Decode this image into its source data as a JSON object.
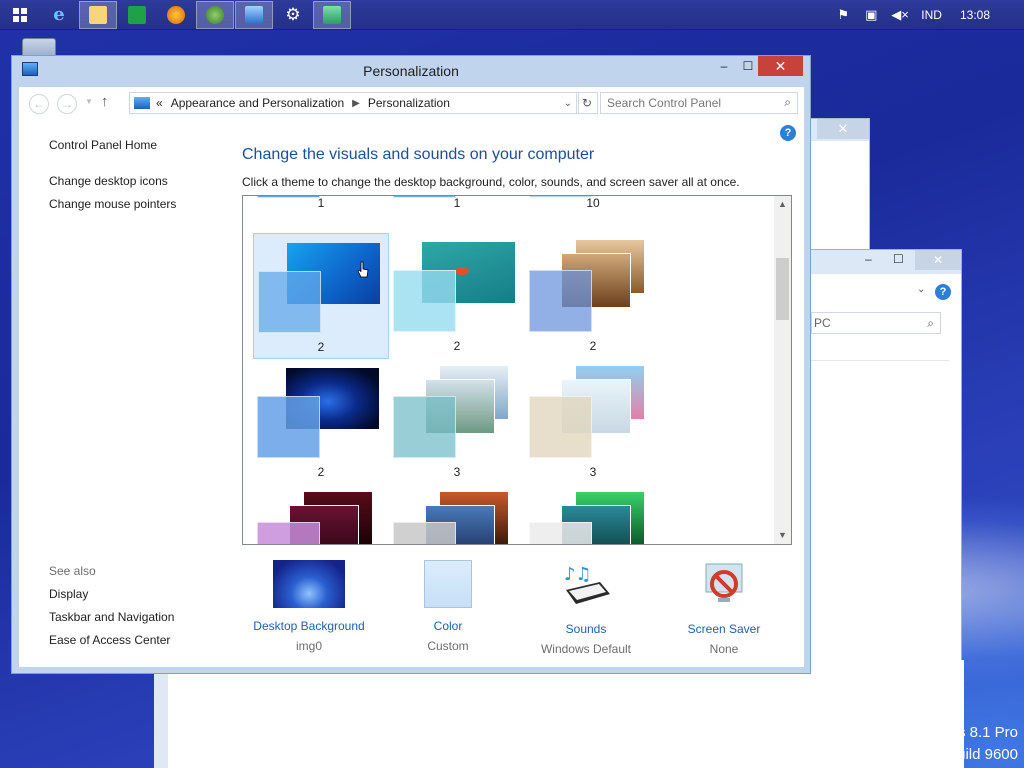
{
  "taskbar": {
    "lang": "IND",
    "clock": "13:08"
  },
  "window": {
    "title": "Personalization",
    "breadcrumb": [
      "Appearance and Personalization",
      "Personalization"
    ],
    "breadcrumb_prefix": "«",
    "search_placeholder": "Search Control Panel",
    "min_label": "–",
    "max_label": "☐",
    "close_label": "✕",
    "help_label": "?"
  },
  "sidebar": {
    "home": "Control Panel Home",
    "links": [
      "Change desktop icons",
      "Change mouse pointers"
    ],
    "see_also_title": "See also",
    "see_also": [
      "Display",
      "Taskbar and Navigation",
      "Ease of Access Center"
    ]
  },
  "main": {
    "heading": "Change the visuals and sounds on your computer",
    "subheading": "Click a theme to change the desktop background, color, sounds, and screen saver all at once."
  },
  "themes": [
    {
      "label": "1",
      "row": -1,
      "col": 0
    },
    {
      "label": "1",
      "row": -1,
      "col": 1
    },
    {
      "label": "10",
      "row": -1,
      "col": 2
    },
    {
      "label": "2",
      "row": 0,
      "col": 0,
      "selected": true
    },
    {
      "label": "2",
      "row": 0,
      "col": 1
    },
    {
      "label": "2",
      "row": 0,
      "col": 2
    },
    {
      "label": "2",
      "row": 1,
      "col": 0
    },
    {
      "label": "3",
      "row": 1,
      "col": 1
    },
    {
      "label": "3",
      "row": 1,
      "col": 2
    }
  ],
  "bottom": {
    "items": [
      {
        "label": "Desktop Background",
        "value": "img0",
        "icon": "wallpaper-thumbnail-icon"
      },
      {
        "label": "Color",
        "value": "Custom",
        "icon": "color-swatch-icon"
      },
      {
        "label": "Sounds",
        "value": "Windows Default",
        "icon": "sounds-piano-icon"
      },
      {
        "label": "Screen Saver",
        "value": "None",
        "icon": "screen-saver-icon"
      }
    ]
  },
  "background_windows": {
    "search_fragment": "PC"
  },
  "desktop": {
    "version_line1": "s 8.1 Pro",
    "version_line2": "uild 9600"
  },
  "colors": {
    "accent_link": "#1e5fb0",
    "heading": "#1e4e9a",
    "close_red": "#c7423a",
    "window_frame": "#c0d4ee"
  }
}
